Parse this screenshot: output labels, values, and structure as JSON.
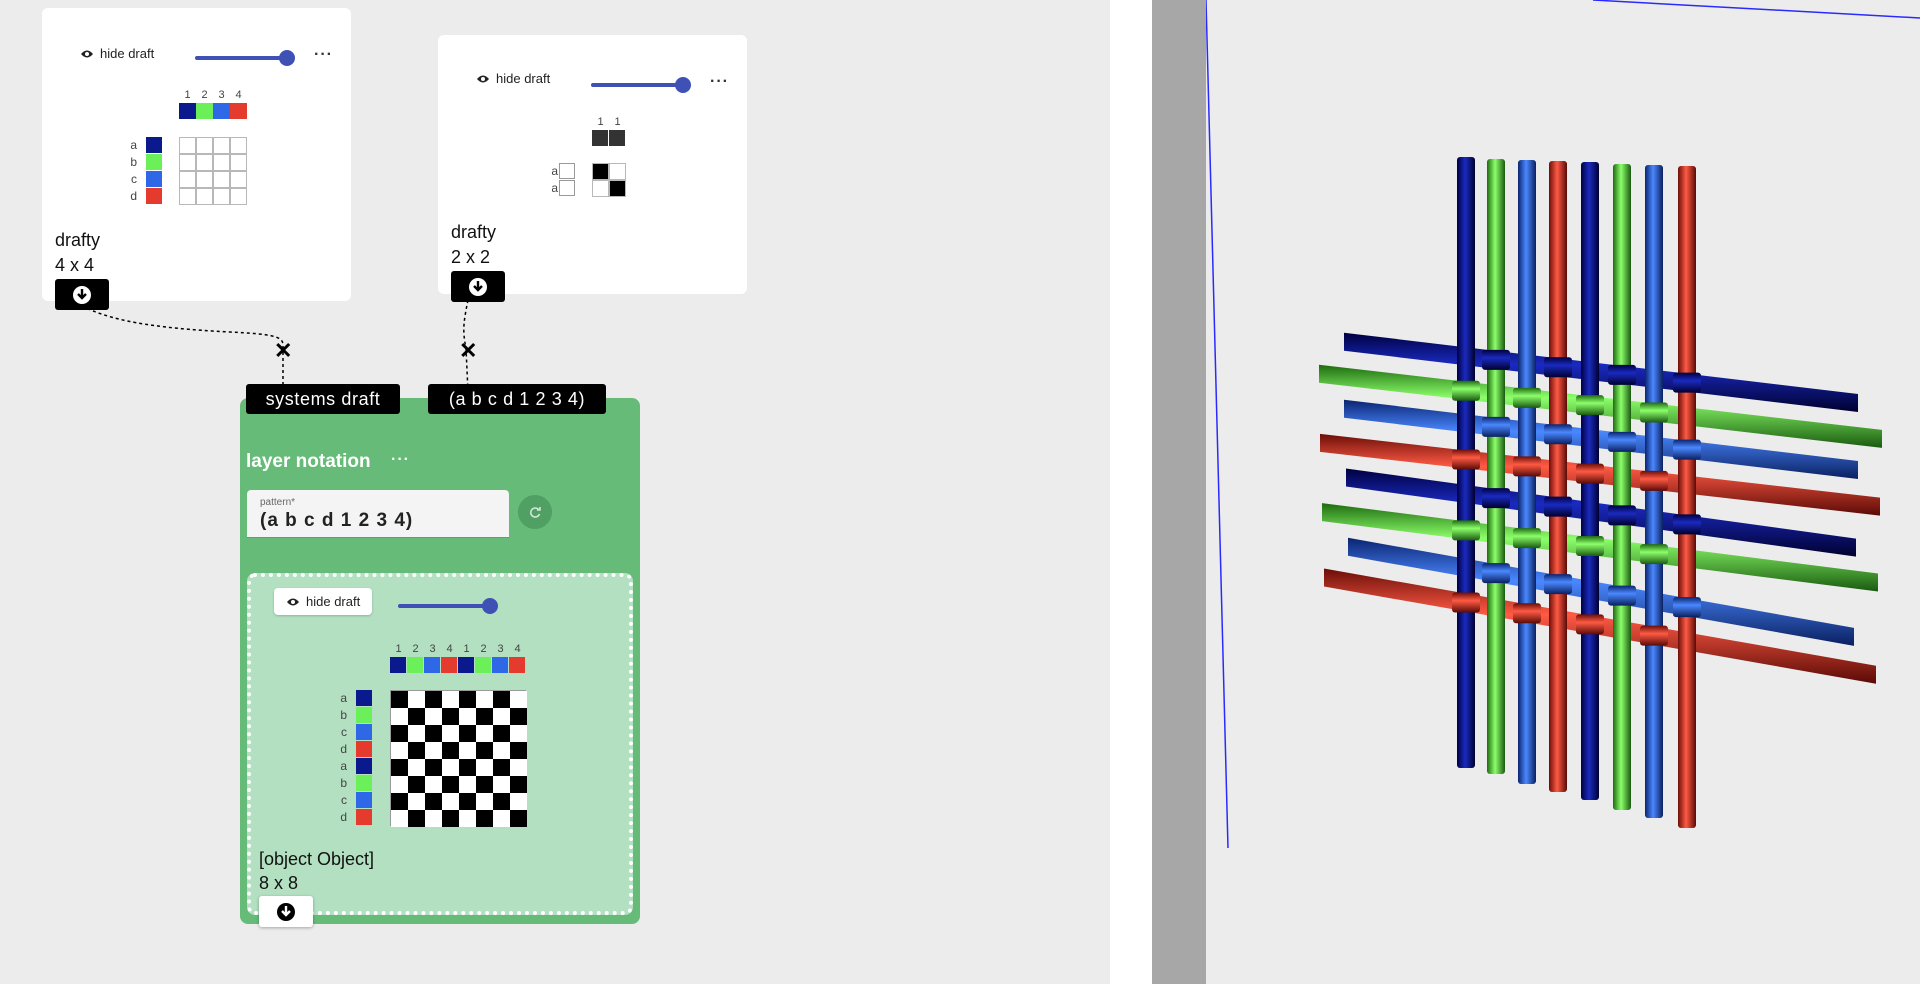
{
  "draft1": {
    "hide_label": "hide draft",
    "more": "···",
    "name": "drafty",
    "size": "4 x 4",
    "warp_ticks": [
      "1",
      "2",
      "3",
      "4"
    ],
    "warp_colors": [
      "#0a1a8c",
      "#6cf05a",
      "#2f68e6",
      "#e53a2e"
    ],
    "weft_labels": [
      "a",
      "b",
      "c",
      "d"
    ],
    "weft_colors": [
      "#0a1a8c",
      "#6cf05a",
      "#2f68e6",
      "#e53a2e"
    ],
    "slider_value": 1.0
  },
  "draft2": {
    "hide_label": "hide draft",
    "more": "···",
    "name": "drafty",
    "size": "2 x 2",
    "warp_ticks": [
      "1",
      "1"
    ],
    "weft_labels": [
      "a",
      "a"
    ],
    "slider_value": 1.0
  },
  "layer": {
    "inlet1": "systems draft",
    "inlet2": "(a b c d 1 2 3 4)",
    "name": "layer notation",
    "more": "···",
    "pattern_label": "pattern*",
    "pattern_value": "(a b c d 1 2 3 4)",
    "output": {
      "hide_label": "hide draft",
      "name": "[object Object]",
      "size": "8 x 8",
      "warp_ticks": [
        "1",
        "2",
        "3",
        "4",
        "1",
        "2",
        "3",
        "4"
      ],
      "weft_labels": [
        "a",
        "b",
        "c",
        "d",
        "a",
        "b",
        "c",
        "d"
      ],
      "colors": [
        "#0a1a8c",
        "#6cf05a",
        "#2f68e6",
        "#e53a2e",
        "#0a1a8c",
        "#6cf05a",
        "#2f68e6",
        "#e53a2e"
      ],
      "slider_value": 1.0
    }
  },
  "icons": {
    "eye": "eye-icon",
    "download": "download-icon",
    "close": "close-icon",
    "refresh": "refresh-icon"
  },
  "accent": "#3f51b5",
  "layer_color": "#66bb78"
}
